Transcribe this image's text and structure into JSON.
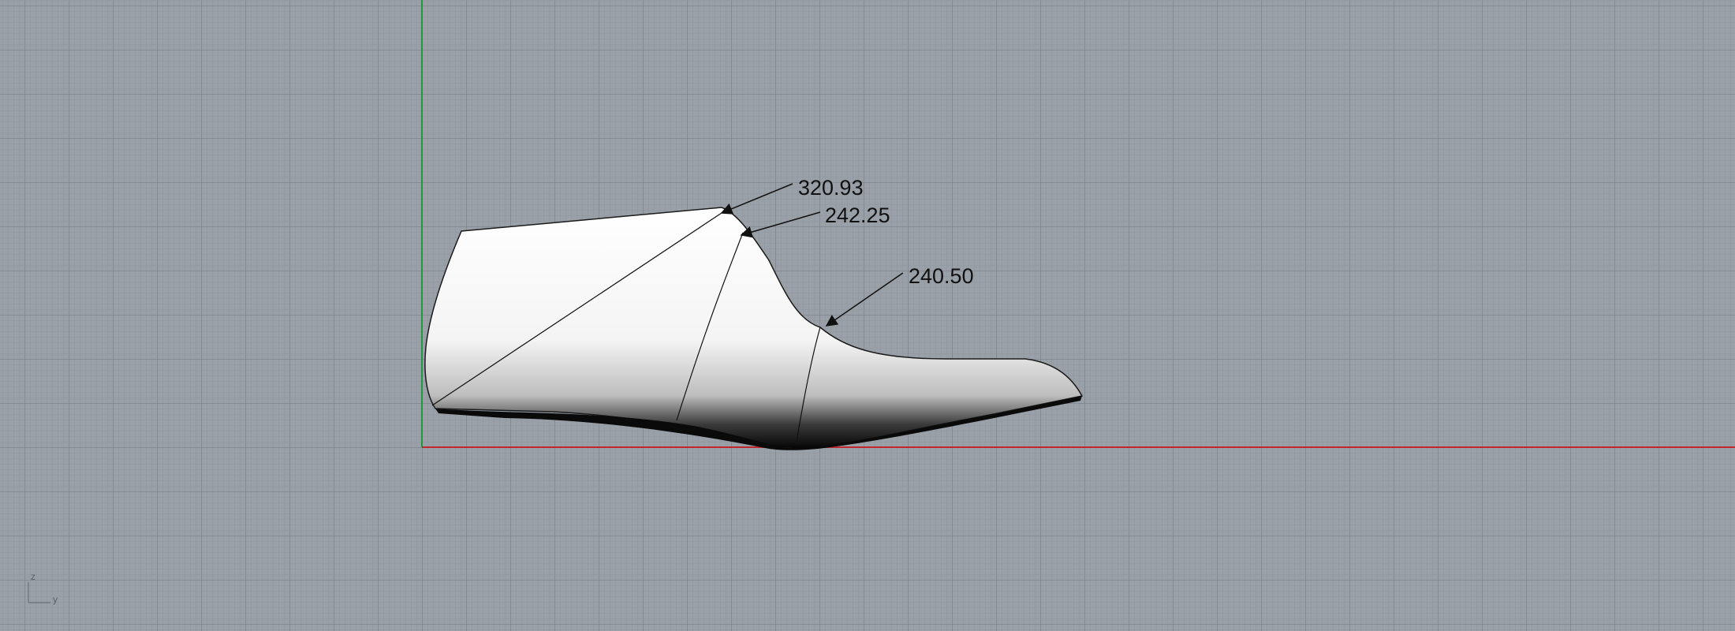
{
  "viewport": {
    "background_color": "#9aa0a8",
    "x_axis_color": "#c0262b",
    "y_axis_color": "#1f9a3a"
  },
  "dimensions": [
    {
      "value": "320.93"
    },
    {
      "value": "242.25"
    },
    {
      "value": "240.50"
    }
  ],
  "axis_widget": {
    "z_label": "z",
    "y_label": "y"
  }
}
